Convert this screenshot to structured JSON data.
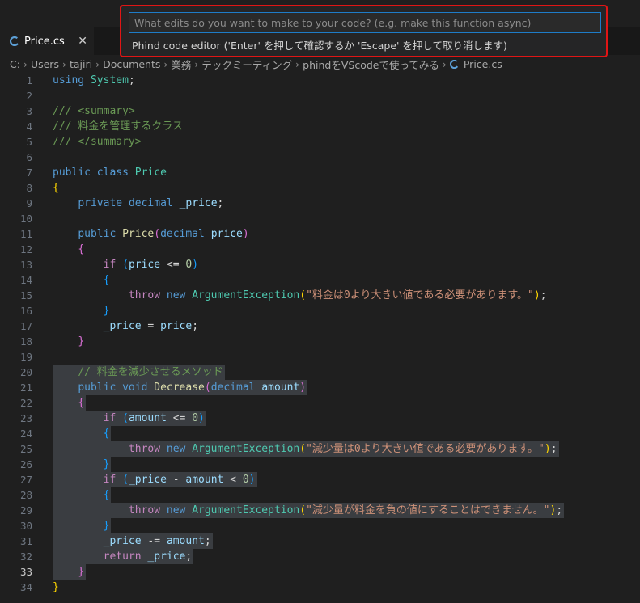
{
  "prompt": {
    "placeholder": "What edits do you want to make to your code? (e.g. make this function async)",
    "hint": "Phind code editor ('Enter' を押して確認するか 'Escape' を押して取り消します)"
  },
  "tab": {
    "label": "Price.cs",
    "close_glyph": "✕",
    "icon": "csharp-icon"
  },
  "breadcrumb": [
    "C:",
    "Users",
    "tajiri",
    "Documents",
    "業務",
    "テックミーティング",
    "phindをVScodeで使ってみる",
    "Price.cs"
  ],
  "editor": {
    "active_line": 33,
    "selection_lines": [
      20,
      33
    ],
    "lines": [
      [
        {
          "t": "using",
          "c": "kw"
        },
        {
          "t": " "
        },
        {
          "t": "System",
          "c": "ty"
        },
        {
          "t": ";"
        }
      ],
      [],
      [
        {
          "t": "/// ",
          "c": "cm"
        },
        {
          "t": "<summary>",
          "c": "cm"
        }
      ],
      [
        {
          "t": "/// 料金を管理するクラス",
          "c": "cm"
        }
      ],
      [
        {
          "t": "/// </summary>",
          "c": "cm"
        }
      ],
      [],
      [
        {
          "t": "public",
          "c": "kw"
        },
        {
          "t": " "
        },
        {
          "t": "class",
          "c": "kw"
        },
        {
          "t": " "
        },
        {
          "t": "Price",
          "c": "ty"
        }
      ],
      [
        {
          "t": "{",
          "c": "br1"
        }
      ],
      [
        {
          "t": "    "
        },
        {
          "t": "private",
          "c": "kw"
        },
        {
          "t": " "
        },
        {
          "t": "decimal",
          "c": "kw"
        },
        {
          "t": " "
        },
        {
          "t": "_price",
          "c": "var"
        },
        {
          "t": ";"
        }
      ],
      [],
      [
        {
          "t": "    "
        },
        {
          "t": "public",
          "c": "kw"
        },
        {
          "t": " "
        },
        {
          "t": "Price",
          "c": "fn"
        },
        {
          "t": "(",
          "c": "br2"
        },
        {
          "t": "decimal",
          "c": "kw"
        },
        {
          "t": " "
        },
        {
          "t": "price",
          "c": "var"
        },
        {
          "t": ")",
          "c": "br2"
        }
      ],
      [
        {
          "t": "    "
        },
        {
          "t": "{",
          "c": "br2"
        }
      ],
      [
        {
          "t": "        "
        },
        {
          "t": "if",
          "c": "ctl"
        },
        {
          "t": " "
        },
        {
          "t": "(",
          "c": "br3"
        },
        {
          "t": "price",
          "c": "var"
        },
        {
          "t": " <= "
        },
        {
          "t": "0",
          "c": "num"
        },
        {
          "t": ")",
          "c": "br3"
        }
      ],
      [
        {
          "t": "        "
        },
        {
          "t": "{",
          "c": "br3"
        }
      ],
      [
        {
          "t": "            "
        },
        {
          "t": "throw",
          "c": "ctl"
        },
        {
          "t": " "
        },
        {
          "t": "new",
          "c": "kw"
        },
        {
          "t": " "
        },
        {
          "t": "ArgumentException",
          "c": "ty"
        },
        {
          "t": "(",
          "c": "br1"
        },
        {
          "t": "\"料金は0より大きい値である必要があります。\"",
          "c": "str"
        },
        {
          "t": ")",
          "c": "br1"
        },
        {
          "t": ";"
        }
      ],
      [
        {
          "t": "        "
        },
        {
          "t": "}",
          "c": "br3"
        }
      ],
      [
        {
          "t": "        "
        },
        {
          "t": "_price",
          "c": "var"
        },
        {
          "t": " = "
        },
        {
          "t": "price",
          "c": "var"
        },
        {
          "t": ";"
        }
      ],
      [
        {
          "t": "    "
        },
        {
          "t": "}",
          "c": "br2"
        }
      ],
      [],
      [
        {
          "t": "    "
        },
        {
          "t": "// 料金を減少させるメソッド",
          "c": "cm"
        }
      ],
      [
        {
          "t": "    "
        },
        {
          "t": "public",
          "c": "kw"
        },
        {
          "t": " "
        },
        {
          "t": "void",
          "c": "kw"
        },
        {
          "t": " "
        },
        {
          "t": "Decrease",
          "c": "fn"
        },
        {
          "t": "(",
          "c": "br2"
        },
        {
          "t": "decimal",
          "c": "kw"
        },
        {
          "t": " "
        },
        {
          "t": "amount",
          "c": "var"
        },
        {
          "t": ")",
          "c": "br2"
        }
      ],
      [
        {
          "t": "    "
        },
        {
          "t": "{",
          "c": "br2"
        }
      ],
      [
        {
          "t": "        "
        },
        {
          "t": "if",
          "c": "ctl"
        },
        {
          "t": " "
        },
        {
          "t": "(",
          "c": "br3"
        },
        {
          "t": "amount",
          "c": "var"
        },
        {
          "t": " <= "
        },
        {
          "t": "0",
          "c": "num"
        },
        {
          "t": ")",
          "c": "br3"
        }
      ],
      [
        {
          "t": "        "
        },
        {
          "t": "{",
          "c": "br3"
        }
      ],
      [
        {
          "t": "            "
        },
        {
          "t": "throw",
          "c": "ctl"
        },
        {
          "t": " "
        },
        {
          "t": "new",
          "c": "kw"
        },
        {
          "t": " "
        },
        {
          "t": "ArgumentException",
          "c": "ty"
        },
        {
          "t": "(",
          "c": "br1"
        },
        {
          "t": "\"減少量は0より大きい値である必要があります。\"",
          "c": "str"
        },
        {
          "t": ")",
          "c": "br1"
        },
        {
          "t": ";"
        }
      ],
      [
        {
          "t": "        "
        },
        {
          "t": "}",
          "c": "br3"
        }
      ],
      [
        {
          "t": "        "
        },
        {
          "t": "if",
          "c": "ctl"
        },
        {
          "t": " "
        },
        {
          "t": "(",
          "c": "br3"
        },
        {
          "t": "_price",
          "c": "var"
        },
        {
          "t": " - "
        },
        {
          "t": "amount",
          "c": "var"
        },
        {
          "t": " < "
        },
        {
          "t": "0",
          "c": "num"
        },
        {
          "t": ")",
          "c": "br3"
        }
      ],
      [
        {
          "t": "        "
        },
        {
          "t": "{",
          "c": "br3"
        }
      ],
      [
        {
          "t": "            "
        },
        {
          "t": "throw",
          "c": "ctl"
        },
        {
          "t": " "
        },
        {
          "t": "new",
          "c": "kw"
        },
        {
          "t": " "
        },
        {
          "t": "ArgumentException",
          "c": "ty"
        },
        {
          "t": "(",
          "c": "br1"
        },
        {
          "t": "\"減少量が料金を負の値にすることはできません。\"",
          "c": "str"
        },
        {
          "t": ")",
          "c": "br1"
        },
        {
          "t": ";"
        }
      ],
      [
        {
          "t": "        "
        },
        {
          "t": "}",
          "c": "br3"
        }
      ],
      [
        {
          "t": "        "
        },
        {
          "t": "_price",
          "c": "var"
        },
        {
          "t": " -= "
        },
        {
          "t": "amount",
          "c": "var"
        },
        {
          "t": ";"
        }
      ],
      [
        {
          "t": "        "
        },
        {
          "t": "return",
          "c": "ctl"
        },
        {
          "t": " "
        },
        {
          "t": "_price",
          "c": "var"
        },
        {
          "t": ";"
        }
      ],
      [
        {
          "t": "    "
        },
        {
          "t": "}",
          "c": "br2"
        }
      ],
      [
        {
          "t": "}",
          "c": "br1"
        }
      ]
    ]
  }
}
